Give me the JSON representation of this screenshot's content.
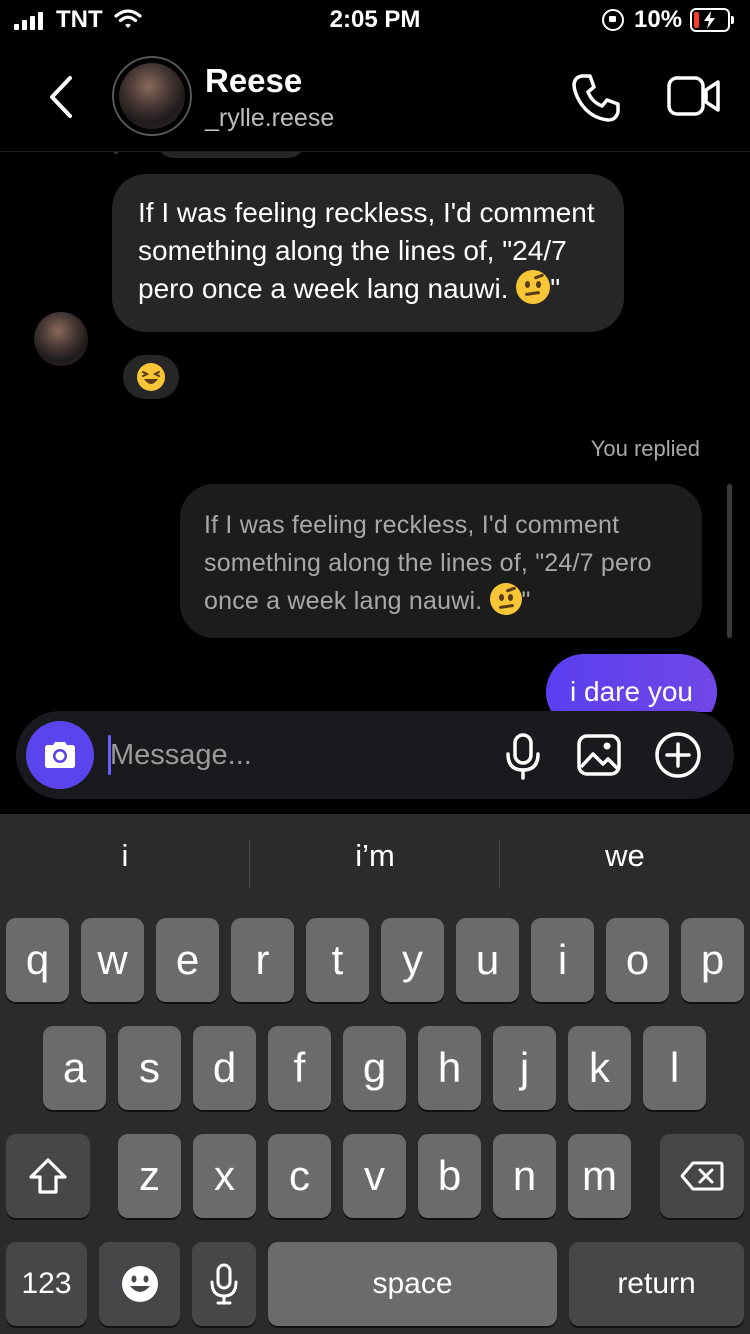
{
  "status_bar": {
    "carrier": "TNT",
    "time": "2:05 PM",
    "battery": "10%"
  },
  "header": {
    "name": "Reese",
    "username": "_rylle.reese"
  },
  "messages": {
    "incoming_text": "If I was feeling reckless, I'd comment something along the lines of, \"24/7 pero once a week lang nauwi. ",
    "incoming_tail": "\"",
    "you_replied": "You replied",
    "quoted_text": "If I was feeling reckless, I'd comment something along the lines of, \"24/7 pero once a week lang nauwi. ",
    "quoted_tail": "\"",
    "outgoing_text": "i dare you"
  },
  "composer": {
    "placeholder": "Message..."
  },
  "keyboard": {
    "suggestions": [
      "i",
      "i’m",
      "we"
    ],
    "row1": [
      "q",
      "w",
      "e",
      "r",
      "t",
      "y",
      "u",
      "i",
      "o",
      "p"
    ],
    "row2": [
      "a",
      "s",
      "d",
      "f",
      "g",
      "h",
      "j",
      "k",
      "l"
    ],
    "row3": [
      "z",
      "x",
      "c",
      "v",
      "b",
      "n",
      "m"
    ],
    "numbers_label": "123",
    "space_label": "space",
    "return_label": "return"
  }
}
